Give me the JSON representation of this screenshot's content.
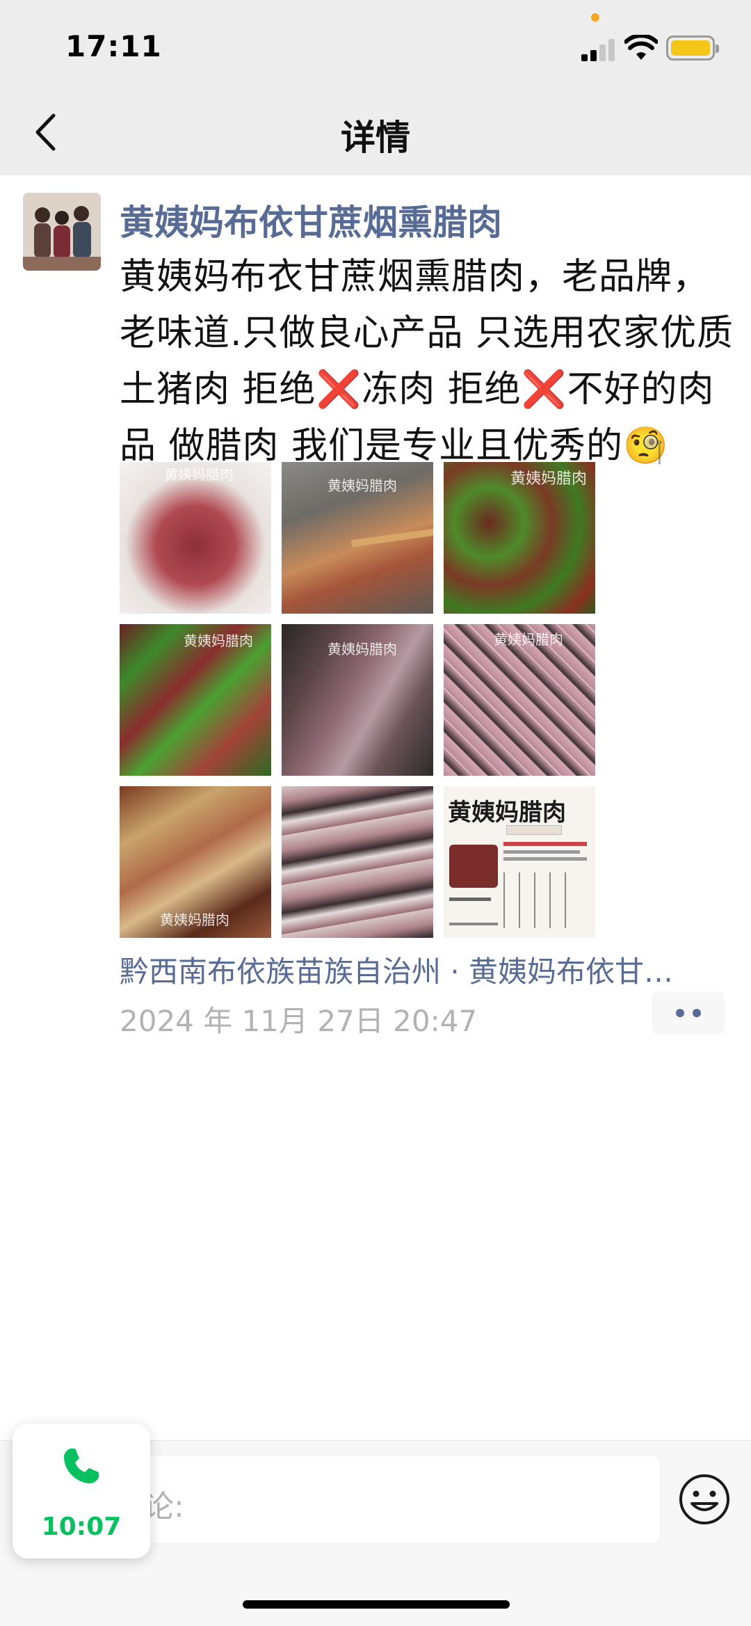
{
  "status_bar": {
    "time": "17:11"
  },
  "nav": {
    "title": "详情"
  },
  "post": {
    "author": "黄姨妈布依甘蔗烟熏腊肉",
    "text": "黄姨妈布衣甘蔗烟熏腊肉，老品牌，老味道.只做良心产品 只选用农家优质土猪肉 拒绝❌冻肉 拒绝❌不好的肉品  做腊肉 我们是专业且优秀的🧐",
    "photos": [
      {
        "watermark": "黄姨妈腊肉",
        "name": "photo-sliced-cured-meat-plate"
      },
      {
        "watermark": "黄姨妈腊肉",
        "name": "photo-cured-meat-chopsticks"
      },
      {
        "watermark": "黄姨妈腊肉",
        "name": "photo-cured-meat-green-peppers"
      },
      {
        "watermark": "黄姨妈腊肉",
        "name": "photo-cured-meat-scallions"
      },
      {
        "watermark": "黄姨妈腊肉",
        "name": "photo-smoked-meat-slab"
      },
      {
        "watermark": "黄姨妈腊肉",
        "name": "photo-diced-cured-meat"
      },
      {
        "watermark": "黄姨妈腊肉",
        "name": "photo-translucent-cured-meat"
      },
      {
        "watermark": "",
        "name": "photo-vacuum-packed-meat"
      },
      {
        "watermark": "",
        "name": "photo-product-flyer",
        "flyer_title": "黄姨妈腊肉"
      }
    ],
    "location": "黔西南布依族苗族自治州 · 黄姨妈布依甘…",
    "timestamp": "2024 年 11月 27日  20:47"
  },
  "comment_bar": {
    "placeholder": "论:"
  },
  "call_bubble": {
    "duration": "10:07"
  },
  "colors": {
    "link": "#576b95",
    "timestamp": "#b2b2b2",
    "call_green": "#07c160",
    "header_bg": "#ededed"
  },
  "icons": [
    "back-chevron-icon",
    "signal-icon",
    "wifi-icon",
    "battery-icon",
    "more-dots-icon",
    "emoji-icon",
    "phone-icon"
  ]
}
